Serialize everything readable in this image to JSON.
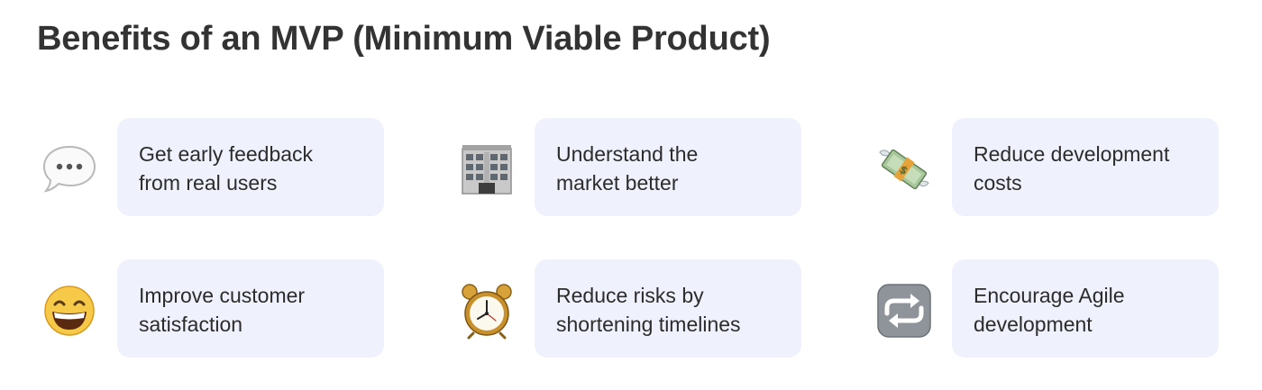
{
  "title": "Benefits of an MVP (Minimum Viable Product)",
  "benefits": [
    {
      "text": "Get early feedback\nfrom real users",
      "icon": "speech-bubble-icon"
    },
    {
      "text": "Understand the\nmarket better",
      "icon": "office-building-icon"
    },
    {
      "text": "Reduce development\ncosts",
      "icon": "money-with-wings-icon"
    },
    {
      "text": "Improve customer\nsatisfaction",
      "icon": "grinning-face-icon"
    },
    {
      "text": "Reduce risks by\nshortening timelines",
      "icon": "alarm-clock-icon"
    },
    {
      "text": "Encourage Agile\ndevelopment",
      "icon": "repeat-arrows-icon"
    }
  ],
  "colors": {
    "card_background": "#eff1fd",
    "title_text": "#333333",
    "body_text": "#2c2c2c"
  }
}
